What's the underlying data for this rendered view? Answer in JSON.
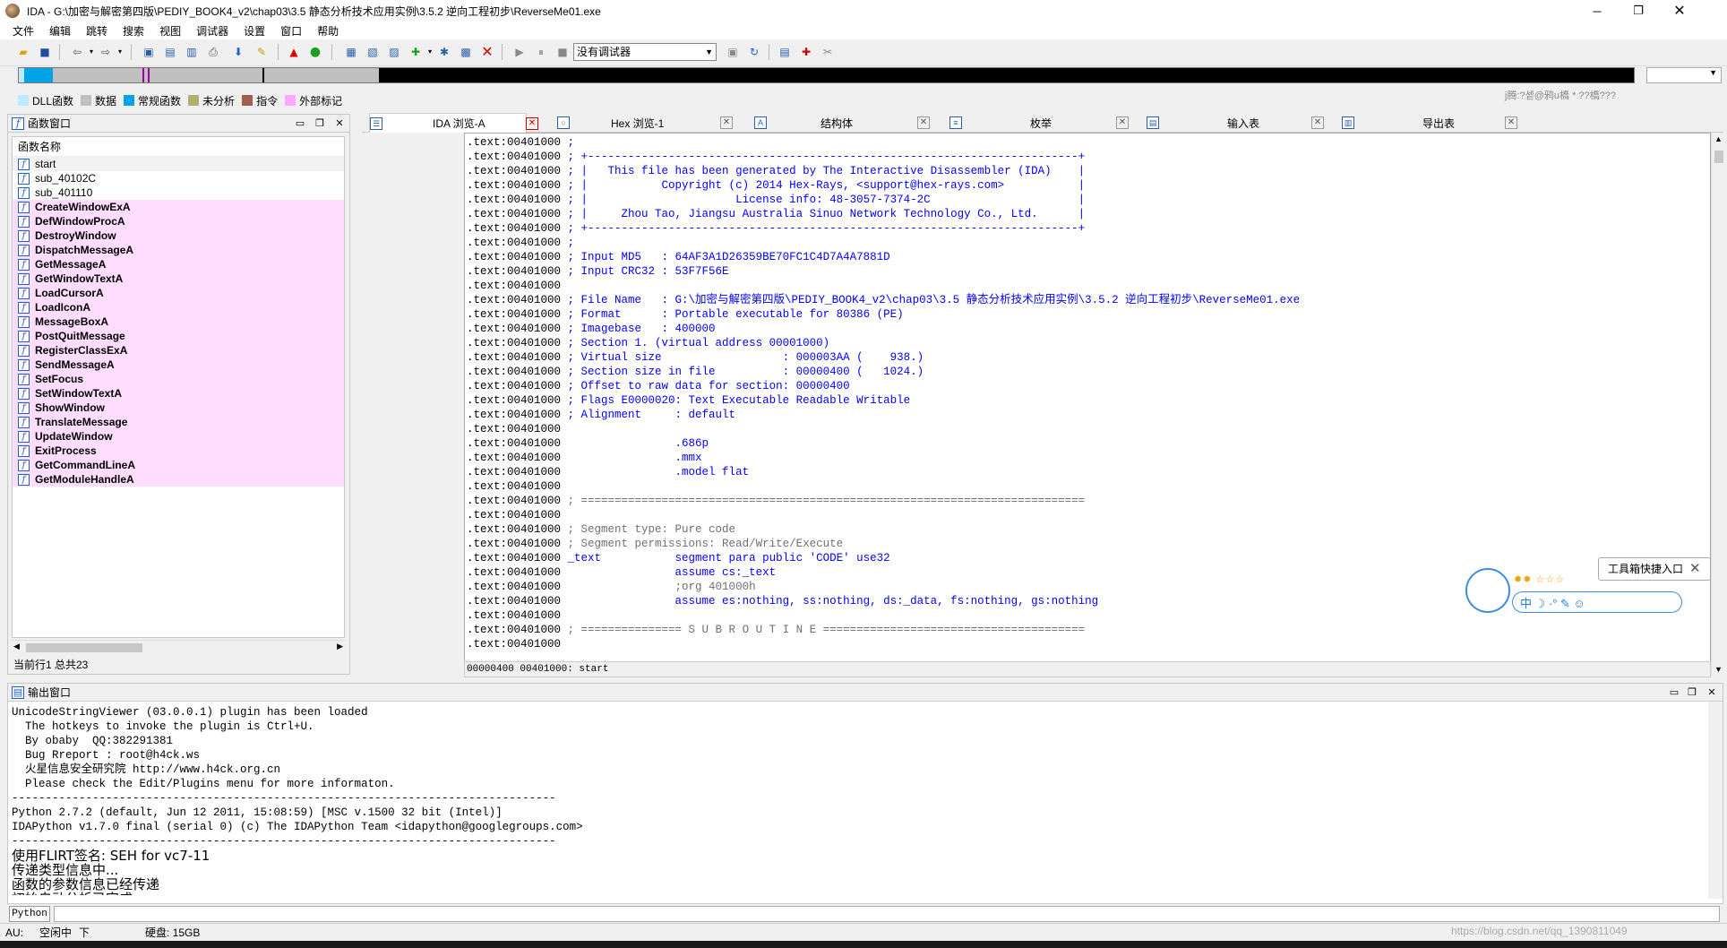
{
  "window": {
    "title": "IDA - G:\\加密与解密第四版\\PEDIY_BOOK4_v2\\chap03\\3.5 静态分析技术应用实例\\3.5.2 逆向工程初步\\ReverseMe01.exe"
  },
  "menu": [
    "文件",
    "编辑",
    "跳转",
    "搜索",
    "视图",
    "调试器",
    "设置",
    "窗口",
    "帮助"
  ],
  "toolbar": {
    "debugger_select": "没有调试器"
  },
  "legend": [
    {
      "label": "DLL函数",
      "color": "#bfe9ff"
    },
    {
      "label": "数据",
      "color": "#c0c0c0"
    },
    {
      "label": "常规函数",
      "color": "#00a2e8"
    },
    {
      "label": "未分析",
      "color": "#b0b070"
    },
    {
      "label": "指令",
      "color": "#a06050"
    },
    {
      "label": "外部标记",
      "color": "#ffaaff"
    }
  ],
  "ime_hint": "j腾:?셑@鸦u橋 * ??橋???",
  "functions_panel": {
    "title": "函数窗口",
    "column": "函数名称",
    "items": [
      {
        "name": "start",
        "ext": false
      },
      {
        "name": "sub_40102C",
        "ext": false
      },
      {
        "name": "sub_401110",
        "ext": false
      },
      {
        "name": "CreateWindowExA",
        "ext": true
      },
      {
        "name": "DefWindowProcA",
        "ext": true
      },
      {
        "name": "DestroyWindow",
        "ext": true
      },
      {
        "name": "DispatchMessageA",
        "ext": true
      },
      {
        "name": "GetMessageA",
        "ext": true
      },
      {
        "name": "GetWindowTextA",
        "ext": true
      },
      {
        "name": "LoadCursorA",
        "ext": true
      },
      {
        "name": "LoadIconA",
        "ext": true
      },
      {
        "name": "MessageBoxA",
        "ext": true
      },
      {
        "name": "PostQuitMessage",
        "ext": true
      },
      {
        "name": "RegisterClassExA",
        "ext": true
      },
      {
        "name": "SendMessageA",
        "ext": true
      },
      {
        "name": "SetFocus",
        "ext": true
      },
      {
        "name": "SetWindowTextA",
        "ext": true
      },
      {
        "name": "ShowWindow",
        "ext": true
      },
      {
        "name": "TranslateMessage",
        "ext": true
      },
      {
        "name": "UpdateWindow",
        "ext": true
      },
      {
        "name": "ExitProcess",
        "ext": true
      },
      {
        "name": "GetCommandLineA",
        "ext": true
      },
      {
        "name": "GetModuleHandleA",
        "ext": true
      }
    ],
    "status": "当前行1  总共23"
  },
  "tabs": [
    {
      "label": "IDA 浏览-A",
      "icon": "list-icon",
      "active": true
    },
    {
      "label": "Hex 浏览-1",
      "icon": "hex-icon"
    },
    {
      "label": "结构体",
      "icon": "struct-icon"
    },
    {
      "label": "枚举",
      "icon": "enum-icon"
    },
    {
      "label": "输入表",
      "icon": "imports-icon"
    },
    {
      "label": "导出表",
      "icon": "exports-icon"
    }
  ],
  "code_lines": [
    {
      "a": ".text:00401000",
      "c": " ;",
      "k": "cm"
    },
    {
      "a": ".text:00401000",
      "c": " ; +-------------------------------------------------------------------------+",
      "k": "cm"
    },
    {
      "a": ".text:00401000",
      "c": " ; |   This file has been generated by The Interactive Disassembler (IDA)    |",
      "k": "cm"
    },
    {
      "a": ".text:00401000",
      "c": " ; |           Copyright (c) 2014 Hex-Rays, <support@hex-rays.com>           |",
      "k": "cm"
    },
    {
      "a": ".text:00401000",
      "c": " ; |                      License info: 48-3057-7374-2C                      |",
      "k": "cm"
    },
    {
      "a": ".text:00401000",
      "c": " ; |     Zhou Tao, Jiangsu Australia Sinuo Network Technology Co., Ltd.      |",
      "k": "cm"
    },
    {
      "a": ".text:00401000",
      "c": " ; +-------------------------------------------------------------------------+",
      "k": "cm"
    },
    {
      "a": ".text:00401000",
      "c": " ;",
      "k": "cm"
    },
    {
      "a": ".text:00401000",
      "c": " ; Input MD5   : 64AF3A1D26359BE70FC1C4D7A4A7881D",
      "k": "cm"
    },
    {
      "a": ".text:00401000",
      "c": " ; Input CRC32 : 53F7F56E",
      "k": "cm"
    },
    {
      "a": ".text:00401000",
      "c": "",
      "k": "cm"
    },
    {
      "a": ".text:00401000",
      "c": " ; File Name   : G:\\加密与解密第四版\\PEDIY_BOOK4_v2\\chap03\\3.5 静态分析技术应用实例\\3.5.2 逆向工程初步\\ReverseMe01.exe",
      "k": "cm"
    },
    {
      "a": ".text:00401000",
      "c": " ; Format      : Portable executable for 80386 (PE)",
      "k": "cm"
    },
    {
      "a": ".text:00401000",
      "c": " ; Imagebase   : 400000",
      "k": "cm"
    },
    {
      "a": ".text:00401000",
      "c": " ; Section 1. (virtual address 00001000)",
      "k": "cm"
    },
    {
      "a": ".text:00401000",
      "c": " ; Virtual size                  : 000003AA (    938.)",
      "k": "cm"
    },
    {
      "a": ".text:00401000",
      "c": " ; Section size in file          : 00000400 (   1024.)",
      "k": "cm"
    },
    {
      "a": ".text:00401000",
      "c": " ; Offset to raw data for section: 00000400",
      "k": "cm"
    },
    {
      "a": ".text:00401000",
      "c": " ; Flags E0000020: Text Executable Readable Writable",
      "k": "cm"
    },
    {
      "a": ".text:00401000",
      "c": " ; Alignment     : default",
      "k": "cm"
    },
    {
      "a": ".text:00401000",
      "c": "",
      "k": "cm"
    },
    {
      "a": ".text:00401000",
      "c": "                 .686p",
      "k": "ins"
    },
    {
      "a": ".text:00401000",
      "c": "                 .mmx",
      "k": "ins"
    },
    {
      "a": ".text:00401000",
      "c": "                 .model flat",
      "k": "ins"
    },
    {
      "a": ".text:00401000",
      "c": "",
      "k": "cm"
    },
    {
      "a": ".text:00401000",
      "c": " ; ===========================================================================",
      "k": "cmg"
    },
    {
      "a": ".text:00401000",
      "c": "",
      "k": "cm"
    },
    {
      "a": ".text:00401000",
      "c": " ; Segment type: Pure code",
      "k": "cmg"
    },
    {
      "a": ".text:00401000",
      "c": " ; Segment permissions: Read/Write/Execute",
      "k": "cmg"
    },
    {
      "a": ".text:00401000",
      "c": " _text           segment para public 'CODE' use32",
      "k": "ins"
    },
    {
      "a": ".text:00401000",
      "c": "                 assume cs:_text",
      "k": "ins"
    },
    {
      "a": ".text:00401000",
      "c": "                 ;org 401000h",
      "k": "cmg"
    },
    {
      "a": ".text:00401000",
      "c": "                 assume es:nothing, ss:nothing, ds:_data, fs:nothing, gs:nothing",
      "k": "ins"
    },
    {
      "a": ".text:00401000",
      "c": "",
      "k": "cm"
    },
    {
      "a": ".text:00401000",
      "c": " ; =============== S U B R O U T I N E =======================================",
      "k": "cmg"
    },
    {
      "a": ".text:00401000",
      "c": "",
      "k": "cm"
    }
  ],
  "ida_status": "00000400 00401000: start",
  "widget": {
    "tip": "工具箱快捷入口",
    "bar": "中 ☽ ·° ✎ ☺"
  },
  "output_panel": {
    "title": "输出窗口",
    "lines": [
      {
        "t": "UnicodeStringViewer (03.0.0.1) plugin has been loaded",
        "big": false
      },
      {
        "t": "  The hotkeys to invoke the plugin is Ctrl+U.",
        "big": false
      },
      {
        "t": "  By obaby  QQ:382291381",
        "big": false
      },
      {
        "t": "  Bug Rreport : root@h4ck.ws",
        "big": false
      },
      {
        "t": "  火星信息安全研究院 http://www.h4ck.org.cn",
        "big": false
      },
      {
        "t": "  Please check the Edit/Plugins menu for more informaton.",
        "big": false
      },
      {
        "t": "---------------------------------------------------------------------------------",
        "big": false
      },
      {
        "t": "Python 2.7.2 (default, Jun 12 2011, 15:08:59) [MSC v.1500 32 bit (Intel)]",
        "big": false
      },
      {
        "t": "IDAPython v1.7.0 final (serial 0) (c) The IDAPython Team <idapython@googlegroups.com>",
        "big": false
      },
      {
        "t": "---------------------------------------------------------------------------------",
        "big": false
      },
      {
        "t": "使用FLIRT签名: SEH for vc7-11",
        "big": true
      },
      {
        "t": "传递类型信息中...",
        "big": true
      },
      {
        "t": "函数的参数信息已经传递",
        "big": true
      },
      {
        "t": "初始自动分析已完成",
        "big": true
      }
    ]
  },
  "python_button": "Python",
  "statusbar": {
    "au": "AU:",
    "state": "空闲中",
    "dir": "下",
    "disk": "硬盘: 15GB"
  },
  "watermark": "https://blog.csdn.net/qq_1390811049"
}
